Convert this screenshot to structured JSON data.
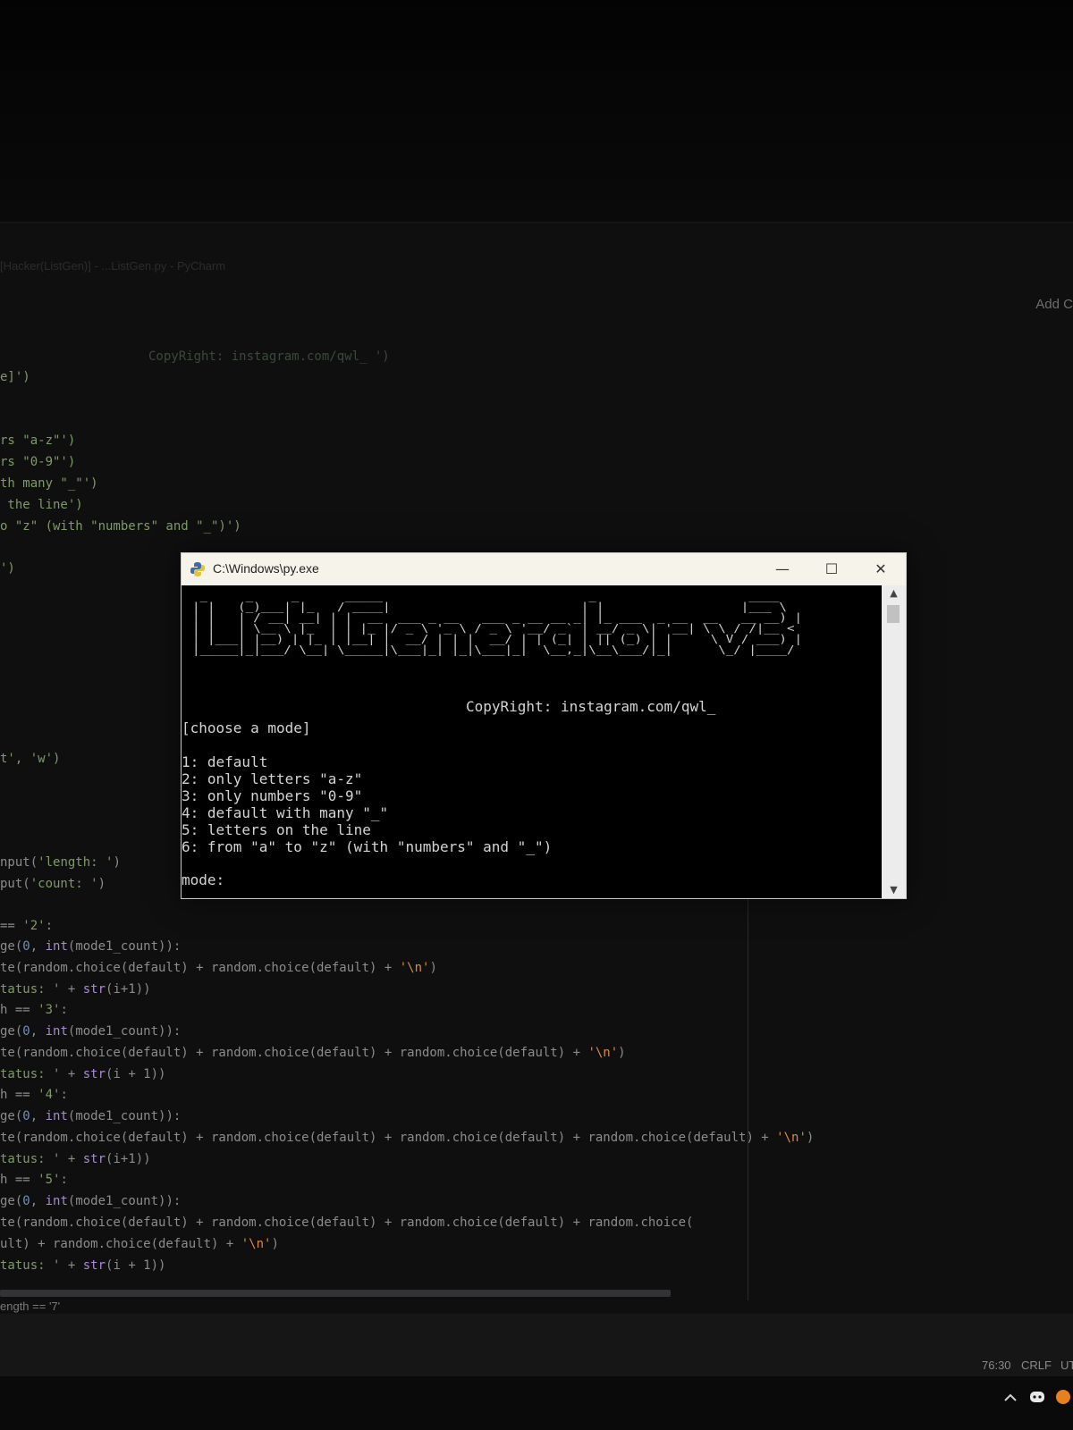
{
  "editor": {
    "title_fragment": "[Hacker(ListGen)] - ...ListGen.py - PyCharm",
    "add_label": "Add C",
    "lines": [
      {
        "parts": [
          {
            "t": "CopyRight: instagram.com/qwl_ ')",
            "c": "dim"
          }
        ]
      },
      {
        "parts": [
          {
            "t": "e]')",
            "c": "str"
          }
        ]
      },
      {
        "parts": [
          {
            "t": "rs \"a-z\"')",
            "c": "str"
          }
        ]
      },
      {
        "parts": [
          {
            "t": "rs \"0-9\"')",
            "c": "str"
          }
        ]
      },
      {
        "parts": [
          {
            "t": "th many \"_\"')",
            "c": "str"
          }
        ]
      },
      {
        "parts": [
          {
            "t": " the line')",
            "c": "str"
          }
        ]
      },
      {
        "parts": [
          {
            "t": "o \"z\" (with \"numbers\" and \"_\")')",
            "c": "str"
          }
        ]
      },
      {
        "parts": [
          {
            "t": "')",
            "c": "str"
          }
        ]
      },
      {
        "parts": [
          {
            "t": "t', 'w')",
            "c": "str"
          }
        ]
      },
      {
        "parts": [
          {
            "t": "nput(",
            "c": "fn"
          },
          {
            "t": "'length: '",
            "c": "str"
          },
          {
            "t": ")",
            "c": "fn"
          }
        ]
      },
      {
        "parts": [
          {
            "t": "put(",
            "c": "fn"
          },
          {
            "t": "'count: '",
            "c": "str"
          },
          {
            "t": ")",
            "c": "fn"
          }
        ]
      },
      {
        "parts": [
          {
            "t": "== ",
            "c": "fn"
          },
          {
            "t": "'2'",
            "c": "str"
          },
          {
            "t": ":",
            "c": "fn"
          }
        ]
      },
      {
        "parts": [
          {
            "t": "ge(",
            "c": "fn"
          },
          {
            "t": "0",
            "c": "num"
          },
          {
            "t": ", ",
            "c": "fn"
          },
          {
            "t": "int",
            "c": "kw"
          },
          {
            "t": "(mode1_count)):",
            "c": "fn"
          }
        ]
      },
      {
        "parts": [
          {
            "t": "te(random.choice(default) + random.choice(default) + ",
            "c": "fn"
          },
          {
            "t": "'\\n'",
            "c": "esc"
          },
          {
            "t": ")",
            "c": "fn"
          }
        ]
      },
      {
        "parts": [
          {
            "t": "tatus: '",
            "c": "str"
          },
          {
            "t": " + ",
            "c": "fn"
          },
          {
            "t": "str",
            "c": "kw"
          },
          {
            "t": "(i+1))",
            "c": "fn"
          }
        ]
      },
      {
        "parts": [
          {
            "t": "h == ",
            "c": "fn"
          },
          {
            "t": "'3'",
            "c": "str"
          },
          {
            "t": ":",
            "c": "fn"
          }
        ]
      },
      {
        "parts": [
          {
            "t": "ge(",
            "c": "fn"
          },
          {
            "t": "0",
            "c": "num"
          },
          {
            "t": ", ",
            "c": "fn"
          },
          {
            "t": "int",
            "c": "kw"
          },
          {
            "t": "(mode1_count)):",
            "c": "fn"
          }
        ]
      },
      {
        "parts": [
          {
            "t": "te(random.choice(default) + random.choice(default) + random.choice(default) + ",
            "c": "fn"
          },
          {
            "t": "'\\n'",
            "c": "esc"
          },
          {
            "t": ")",
            "c": "fn"
          }
        ]
      },
      {
        "parts": [
          {
            "t": "tatus: '",
            "c": "str"
          },
          {
            "t": " + ",
            "c": "fn"
          },
          {
            "t": "str",
            "c": "kw"
          },
          {
            "t": "(i + 1))",
            "c": "fn"
          }
        ]
      },
      {
        "parts": [
          {
            "t": "h == ",
            "c": "fn"
          },
          {
            "t": "'4'",
            "c": "str"
          },
          {
            "t": ":",
            "c": "fn"
          }
        ]
      },
      {
        "parts": [
          {
            "t": "ge(",
            "c": "fn"
          },
          {
            "t": "0",
            "c": "num"
          },
          {
            "t": ", ",
            "c": "fn"
          },
          {
            "t": "int",
            "c": "kw"
          },
          {
            "t": "(mode1_count)):",
            "c": "fn"
          }
        ]
      },
      {
        "parts": [
          {
            "t": "te(random.choice(default) + random.choice(default) + random.choice(default) + random.choice(default) + ",
            "c": "fn"
          },
          {
            "t": "'\\n'",
            "c": "esc"
          },
          {
            "t": ")",
            "c": "fn"
          }
        ]
      },
      {
        "parts": [
          {
            "t": "tatus: '",
            "c": "str"
          },
          {
            "t": " + ",
            "c": "fn"
          },
          {
            "t": "str",
            "c": "kw"
          },
          {
            "t": "(i+1))",
            "c": "fn"
          }
        ]
      },
      {
        "parts": [
          {
            "t": "h == ",
            "c": "fn"
          },
          {
            "t": "'5'",
            "c": "str"
          },
          {
            "t": ":",
            "c": "fn"
          }
        ]
      },
      {
        "parts": [
          {
            "t": "ge(",
            "c": "fn"
          },
          {
            "t": "0",
            "c": "num"
          },
          {
            "t": ", ",
            "c": "fn"
          },
          {
            "t": "int",
            "c": "kw"
          },
          {
            "t": "(mode1_count)):",
            "c": "fn"
          }
        ]
      },
      {
        "parts": [
          {
            "t": "te(random.choice(default) + random.choice(default) + random.choice(default) + random.choice(",
            "c": "fn"
          }
        ]
      },
      {
        "parts": [
          {
            "t": "ult) + random.choice(default) + ",
            "c": "fn"
          },
          {
            "t": "'\\n'",
            "c": "esc"
          },
          {
            "t": ")",
            "c": "fn"
          }
        ]
      },
      {
        "parts": [
          {
            "t": "tatus: '",
            "c": "str"
          },
          {
            "t": " + ",
            "c": "fn"
          },
          {
            "t": "str",
            "c": "kw"
          },
          {
            "t": "(i + 1))",
            "c": "fn"
          }
        ]
      }
    ],
    "bottom_line": "ength == '7'"
  },
  "statusbar": {
    "position": "76:30",
    "line_ending": "CRLF",
    "encoding": "UT"
  },
  "console": {
    "title": "C:\\Windows\\py.exe",
    "minimize_glyph": "—",
    "maximize_glyph": "☐",
    "close_glyph": "✕",
    "ascii_banner": " _     _     _      _____                           _                    ____\n| |   (_)___| |_   / ____|                         | |                  |___ \\\n| |   | / __| __| | |  __  ___ _ __   ___ _ __ __ _| |_ ___  _ __  __   __ __) |\n| |   | \\__ \\ |_  | | |_ |/ _ \\ '_ \\ / _ \\ '__/ _` | __/ _ \\| '__| \\ \\ / /|__ <\n| |___| |__) | |_ | |__| |  __/ | | |  __/ | | (_| | || (_) | |     \\ V / ___) |\n|_____|_|___/ \\__| \\_____|\\___|_| |_|\\___|_|  \\__,_|\\__\\___/|_|      \\_/ |____/",
    "copyright": "CopyRight: instagram.com/qwl_",
    "heading": "[choose a mode]",
    "options": [
      "1: default",
      "2: only letters \"a-z\"",
      "3: only numbers \"0-9\"",
      "4: default with many \"_\"",
      "5: letters on the line",
      "6: from \"a\" to \"z\" (with \"numbers\" and \"_\")"
    ],
    "prompt": "mode:"
  },
  "colors": {
    "console_bg": "#000000",
    "console_text": "#d4d4d4",
    "titlebar_bg": "#f6f3ea",
    "editor_bg": "#0f0f10",
    "string_green": "#7f9a6a",
    "escape_orange": "#d88b3c",
    "number_blue": "#6c8fbf",
    "builtin_purple": "#a98bd0"
  },
  "icons": [
    "python-icon",
    "minimize-icon",
    "maximize-icon",
    "close-icon",
    "scroll-up-icon",
    "scroll-down-icon",
    "chevron-up-icon",
    "discord-icon",
    "app-icon"
  ]
}
